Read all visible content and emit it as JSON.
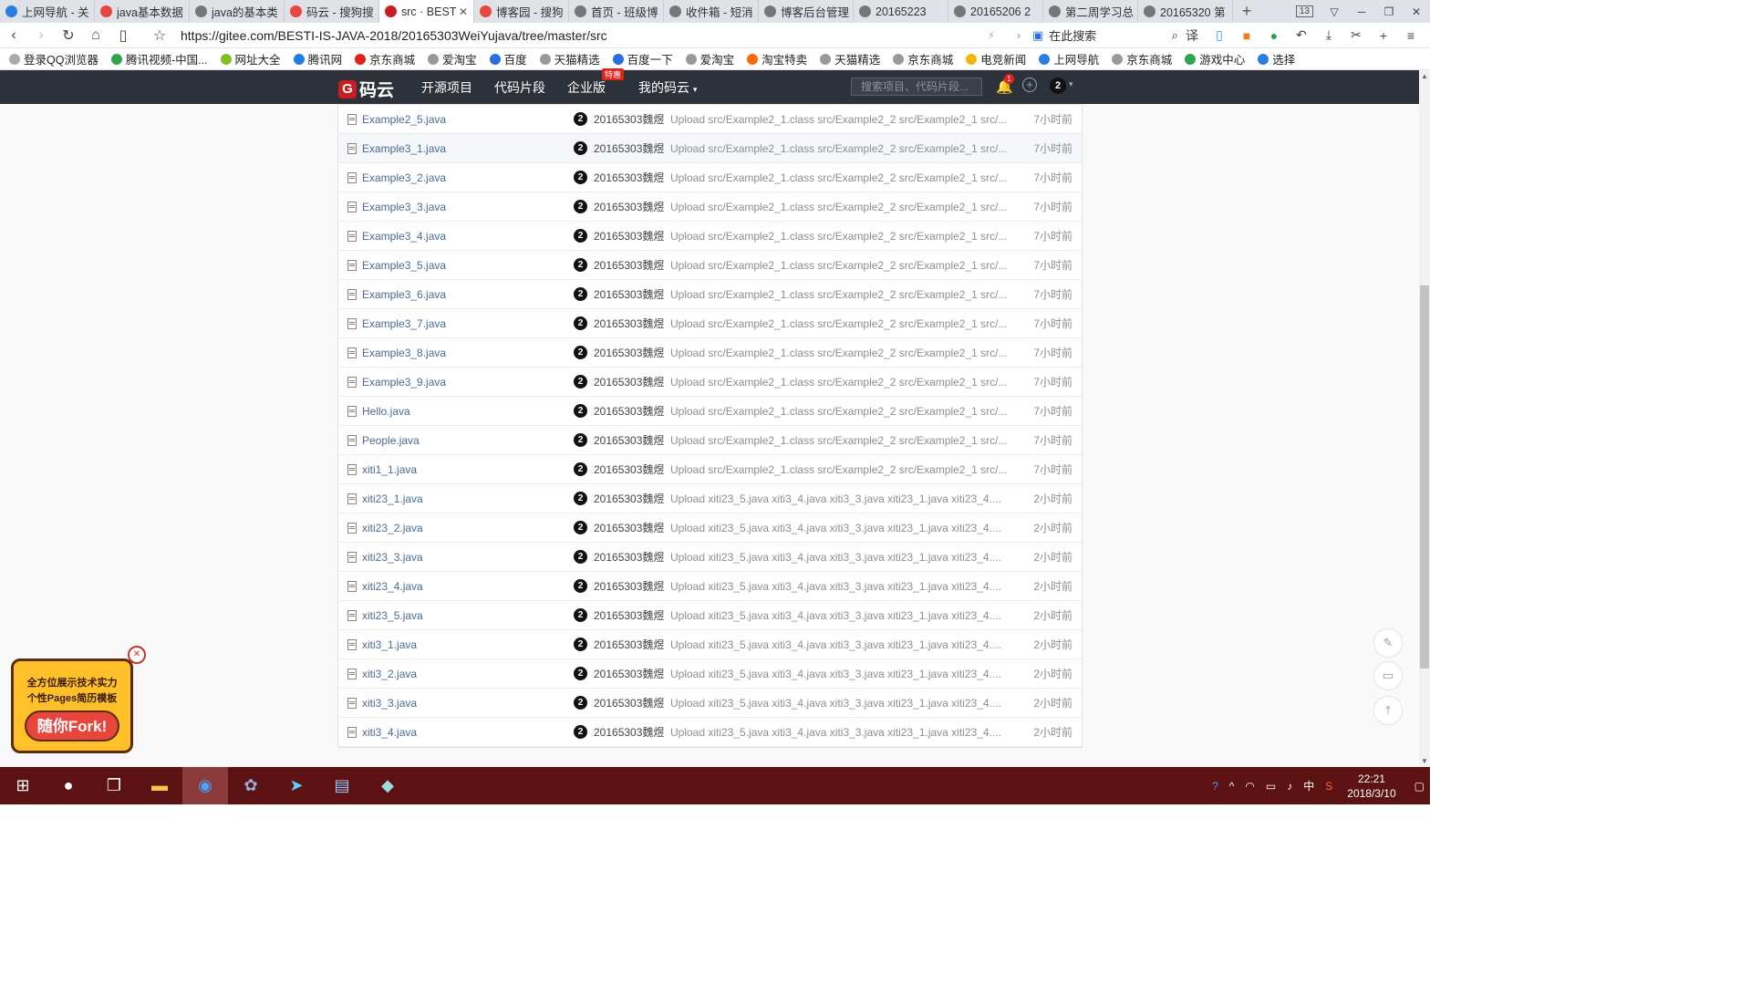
{
  "browser": {
    "tabs": [
      {
        "title": "上网导航 - 关",
        "color": "#2a7de1",
        "active": false
      },
      {
        "title": "java基本数据",
        "color": "#e8453c",
        "active": false
      },
      {
        "title": "java的基本类",
        "color": "#777777",
        "active": false
      },
      {
        "title": "码云 - 搜狗搜",
        "color": "#e8453c",
        "active": false
      },
      {
        "title": "src · BESTI.",
        "color": "#c71d23",
        "active": true
      },
      {
        "title": "博客园 - 搜狗",
        "color": "#e8453c",
        "active": false
      },
      {
        "title": "首页 - 班级博",
        "color": "#777777",
        "active": false
      },
      {
        "title": "收件箱 - 短消",
        "color": "#777777",
        "active": false
      },
      {
        "title": "博客后台管理",
        "color": "#777777",
        "active": false
      },
      {
        "title": "20165223",
        "color": "#777777",
        "active": false
      },
      {
        "title": "20165206 2",
        "color": "#777777",
        "active": false
      },
      {
        "title": "第二周学习总",
        "color": "#777777",
        "active": false
      },
      {
        "title": "20165320 第",
        "color": "#777777",
        "active": false
      }
    ],
    "tab_count": "13",
    "url_host": "https://gitee.com",
    "url_path": "/BESTI-IS-JAVA-2018/20165303WeiYujava/tree/master/src",
    "search_label": "在此搜索",
    "bookmarks": [
      {
        "label": "登录QQ浏览器",
        "color": "#aaaaaa"
      },
      {
        "label": "腾讯视频-中国...",
        "color": "#2da44e"
      },
      {
        "label": "网址大全",
        "color": "#7fbf1f"
      },
      {
        "label": "腾讯网",
        "color": "#1f7de1"
      },
      {
        "label": "京东商城",
        "color": "#e2231a"
      },
      {
        "label": "爱淘宝",
        "color": "#999999"
      },
      {
        "label": "百度",
        "color": "#2a6de1"
      },
      {
        "label": "天猫精选",
        "color": "#999999"
      },
      {
        "label": "百度一下",
        "color": "#2a6de1"
      },
      {
        "label": "爱淘宝",
        "color": "#999999"
      },
      {
        "label": "淘宝特卖",
        "color": "#ff6a00"
      },
      {
        "label": "天猫精选",
        "color": "#999999"
      },
      {
        "label": "京东商城",
        "color": "#999999"
      },
      {
        "label": "电竞新闻",
        "color": "#f2b705"
      },
      {
        "label": "上网导航",
        "color": "#2a7de1"
      },
      {
        "label": "京东商城",
        "color": "#999999"
      },
      {
        "label": "游戏中心",
        "color": "#2da44e"
      },
      {
        "label": "选择",
        "color": "#2a7de1"
      }
    ]
  },
  "gitee": {
    "logo_text": "码云",
    "nav": [
      "开源项目",
      "代码片段",
      "企业版",
      "我的码云"
    ],
    "hot_badge": "特惠",
    "search_placeholder": "搜索项目、代码片段...",
    "notif_count": "1",
    "avatar": "2"
  },
  "files": [
    {
      "name": "Example2_5.java",
      "author": "20165303魏煜",
      "message": "Upload src/Example2_1.class src/Example2_2 src/Example2_1 src/...",
      "time": "7小时前"
    },
    {
      "name": "Example3_1.java",
      "author": "20165303魏煜",
      "message": "Upload src/Example2_1.class src/Example2_2 src/Example2_1 src/...",
      "time": "7小时前"
    },
    {
      "name": "Example3_2.java",
      "author": "20165303魏煜",
      "message": "Upload src/Example2_1.class src/Example2_2 src/Example2_1 src/...",
      "time": "7小时前"
    },
    {
      "name": "Example3_3.java",
      "author": "20165303魏煜",
      "message": "Upload src/Example2_1.class src/Example2_2 src/Example2_1 src/...",
      "time": "7小时前"
    },
    {
      "name": "Example3_4.java",
      "author": "20165303魏煜",
      "message": "Upload src/Example2_1.class src/Example2_2 src/Example2_1 src/...",
      "time": "7小时前"
    },
    {
      "name": "Example3_5.java",
      "author": "20165303魏煜",
      "message": "Upload src/Example2_1.class src/Example2_2 src/Example2_1 src/...",
      "time": "7小时前"
    },
    {
      "name": "Example3_6.java",
      "author": "20165303魏煜",
      "message": "Upload src/Example2_1.class src/Example2_2 src/Example2_1 src/...",
      "time": "7小时前"
    },
    {
      "name": "Example3_7.java",
      "author": "20165303魏煜",
      "message": "Upload src/Example2_1.class src/Example2_2 src/Example2_1 src/...",
      "time": "7小时前"
    },
    {
      "name": "Example3_8.java",
      "author": "20165303魏煜",
      "message": "Upload src/Example2_1.class src/Example2_2 src/Example2_1 src/...",
      "time": "7小时前"
    },
    {
      "name": "Example3_9.java",
      "author": "20165303魏煜",
      "message": "Upload src/Example2_1.class src/Example2_2 src/Example2_1 src/...",
      "time": "7小时前"
    },
    {
      "name": "Hello.java",
      "author": "20165303魏煜",
      "message": "Upload src/Example2_1.class src/Example2_2 src/Example2_1 src/...",
      "time": "7小时前"
    },
    {
      "name": "People.java",
      "author": "20165303魏煜",
      "message": "Upload src/Example2_1.class src/Example2_2 src/Example2_1 src/...",
      "time": "7小时前"
    },
    {
      "name": "xiti1_1.java",
      "author": "20165303魏煜",
      "message": "Upload src/Example2_1.class src/Example2_2 src/Example2_1 src/...",
      "time": "7小时前"
    },
    {
      "name": "xiti23_1.java",
      "author": "20165303魏煜",
      "message": "Upload xiti23_5.java xiti3_4.java xiti3_3.java xiti23_1.java xiti23_4....",
      "time": "2小时前"
    },
    {
      "name": "xiti23_2.java",
      "author": "20165303魏煜",
      "message": "Upload xiti23_5.java xiti3_4.java xiti3_3.java xiti23_1.java xiti23_4....",
      "time": "2小时前"
    },
    {
      "name": "xiti23_3.java",
      "author": "20165303魏煜",
      "message": "Upload xiti23_5.java xiti3_4.java xiti3_3.java xiti23_1.java xiti23_4....",
      "time": "2小时前"
    },
    {
      "name": "xiti23_4.java",
      "author": "20165303魏煜",
      "message": "Upload xiti23_5.java xiti3_4.java xiti3_3.java xiti23_1.java xiti23_4....",
      "time": "2小时前"
    },
    {
      "name": "xiti23_5.java",
      "author": "20165303魏煜",
      "message": "Upload xiti23_5.java xiti3_4.java xiti3_3.java xiti23_1.java xiti23_4....",
      "time": "2小时前"
    },
    {
      "name": "xiti3_1.java",
      "author": "20165303魏煜",
      "message": "Upload xiti23_5.java xiti3_4.java xiti3_3.java xiti23_1.java xiti23_4....",
      "time": "2小时前"
    },
    {
      "name": "xiti3_2.java",
      "author": "20165303魏煜",
      "message": "Upload xiti23_5.java xiti3_4.java xiti3_3.java xiti23_1.java xiti23_4....",
      "time": "2小时前"
    },
    {
      "name": "xiti3_3.java",
      "author": "20165303魏煜",
      "message": "Upload xiti23_5.java xiti3_4.java xiti3_3.java xiti23_1.java xiti23_4....",
      "time": "2小时前"
    },
    {
      "name": "xiti3_4.java",
      "author": "20165303魏煜",
      "message": "Upload xiti23_5.java xiti3_4.java xiti3_3.java xiti23_1.java xiti23_4....",
      "time": "2小时前"
    }
  ],
  "author_avatar": "2",
  "ad": {
    "line1": "全方位展示技术实力",
    "line2": "个性Pages简历模板",
    "button": "随你Fork!"
  },
  "taskbar": {
    "time": "22:21",
    "date": "2018/3/10",
    "ime": "中"
  }
}
